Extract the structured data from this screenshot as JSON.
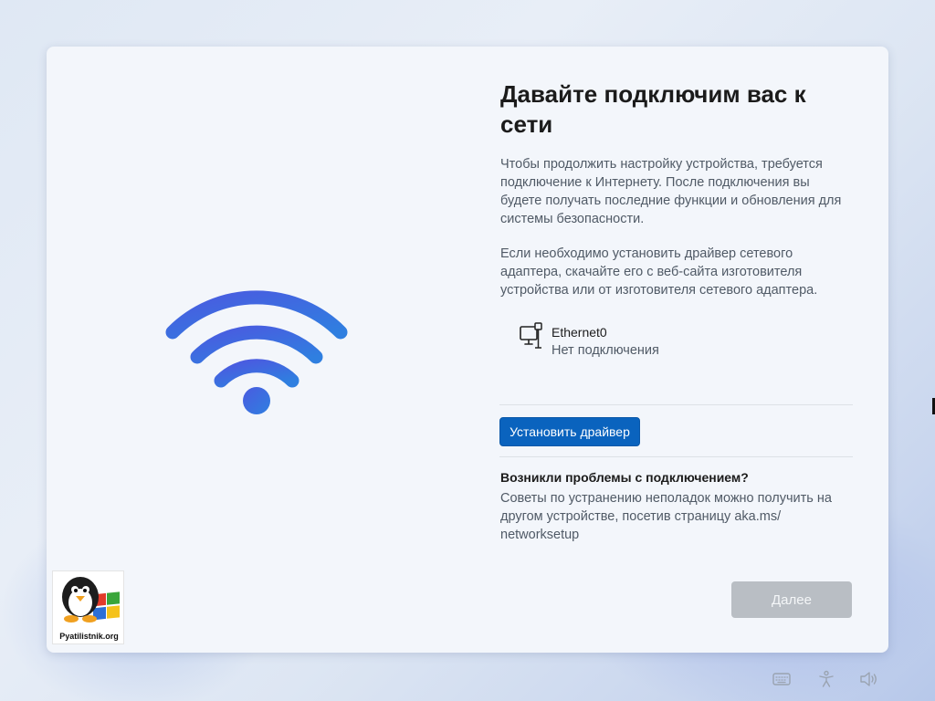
{
  "setup": {
    "title": "Давайте подключим вас к сети",
    "description1": "Чтобы продолжить настройку устройства, требуется подключение к Интернету. После подключения вы будете получать последние функции и обновления для системы безопасности.",
    "description2": "Если необходимо установить драйвер сетевого адаптера, скачайте его с веб-сайта изготовителя устройства или от изготовителя сетевого адаптера.",
    "network": {
      "name": "Ethernet0",
      "status": "Нет подключения",
      "icon": "ethernet-pc-icon"
    },
    "install_driver_label": "Установить драйвер",
    "help_title": "Возникли проблемы с подключением?",
    "help_text": "Советы по устранению неполадок можно получить на другом устройстве, посетив страницу aka.ms/ networksetup",
    "next_label": "Далее"
  },
  "watermark": {
    "text": "Pyatilistnik.org"
  },
  "tray": {
    "icons": [
      "keyboard-icon",
      "accessibility-icon",
      "volume-icon"
    ]
  },
  "colors": {
    "accent": "#0a63be",
    "wifi_gradient_start": "#4a5be0",
    "wifi_gradient_end": "#2f7fe0",
    "disabled_button": "#b9bec4"
  }
}
